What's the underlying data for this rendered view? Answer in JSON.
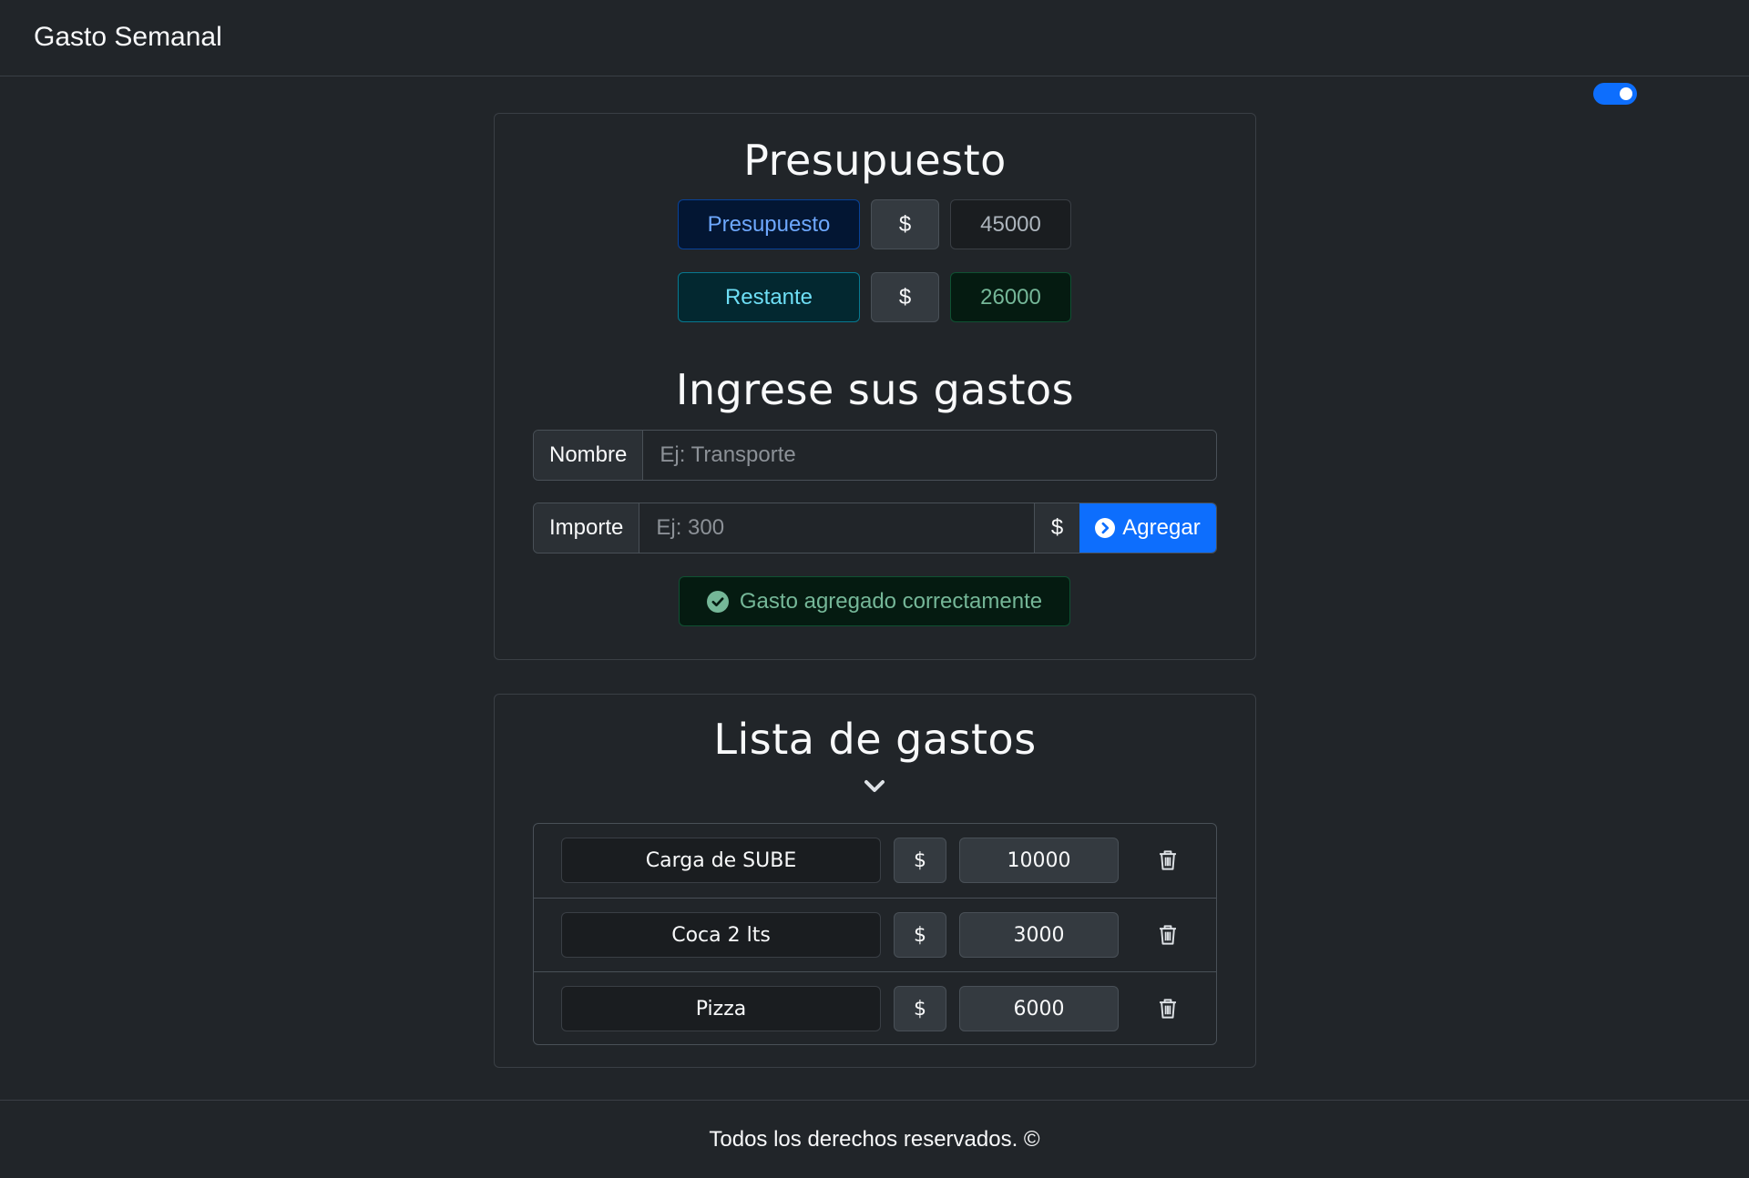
{
  "navbar": {
    "brand": "Gasto Semanal"
  },
  "theme_toggle": {
    "state": "on",
    "color": "#0d6efd"
  },
  "budget": {
    "title": "Presupuesto",
    "budget_label": "Presupuesto",
    "currency": "$",
    "budget_value": "45000",
    "remaining_label": "Restante",
    "remaining_value": "26000"
  },
  "form": {
    "title": "Ingrese sus gastos",
    "name_label": "Nombre",
    "name_placeholder": "Ej: Transporte",
    "amount_label": "Importe",
    "amount_placeholder": "Ej: 300",
    "currency": "$",
    "add_button": "Agregar",
    "add_icon": "chevron-right-circle-icon"
  },
  "alert": {
    "message": "Gasto agregado correctamente",
    "icon": "check-circle-icon",
    "color": "#75b798"
  },
  "expenses": {
    "title": "Lista de gastos",
    "toggle_icon": "chevron-down-icon",
    "items": [
      {
        "name": "Carga de SUBE",
        "currency": "$",
        "amount": "10000",
        "delete_icon": "trash-icon"
      },
      {
        "name": "Coca 2 lts",
        "currency": "$",
        "amount": "3000",
        "delete_icon": "trash-icon"
      },
      {
        "name": "Pizza",
        "currency": "$",
        "amount": "6000",
        "delete_icon": "trash-icon"
      }
    ]
  },
  "footer": {
    "text": "Todos los derechos reservados. ©"
  }
}
